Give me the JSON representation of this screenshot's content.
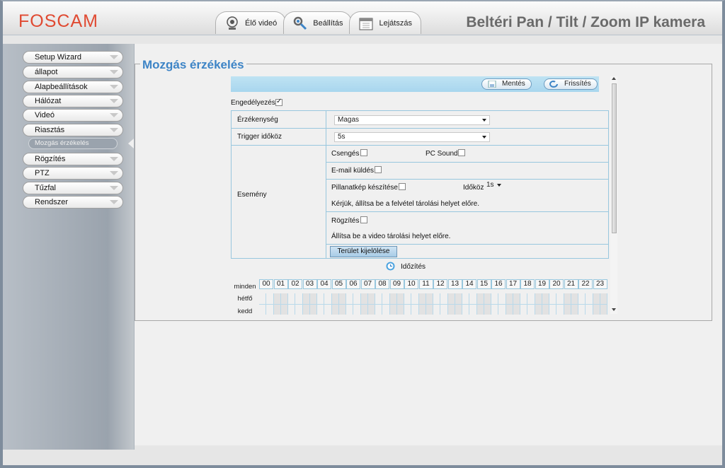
{
  "header": {
    "logo": "FOSCAM",
    "product_title": "Beltéri Pan / Tilt / Zoom IP kamera",
    "tabs": [
      {
        "label": "Élő videó",
        "icon": "webcam-icon"
      },
      {
        "label": "Beállítás",
        "icon": "tools-icon"
      },
      {
        "label": "Lejátszás",
        "icon": "calendar-icon"
      }
    ]
  },
  "sidebar": {
    "items": [
      {
        "label": "Setup Wizard"
      },
      {
        "label": "állapot"
      },
      {
        "label": "Alapbeállítások"
      },
      {
        "label": "Hálózat"
      },
      {
        "label": "Videó"
      },
      {
        "label": "Riasztás"
      },
      {
        "label": "Rögzítés"
      },
      {
        "label": "PTZ"
      },
      {
        "label": "Tűzfal"
      },
      {
        "label": "Rendszer"
      }
    ],
    "active_sub": "Mozgás érzékelés"
  },
  "main": {
    "title": "Mozgás érzékelés",
    "toolbar": {
      "save": "Mentés",
      "refresh": "Frissítés"
    },
    "enable_label": "Engedélyezés",
    "enable_checked": true,
    "sensitivity": {
      "label": "Érzékenység",
      "value": "Magas"
    },
    "trigger": {
      "label": "Trigger időköz",
      "value": "5s"
    },
    "event": {
      "label": "Esemény",
      "ring": "Csengés",
      "pc_sound": "PC Sound",
      "email": "E-mail küldés",
      "snapshot": "Pillanatkép készítése",
      "interval_label": "Időköz",
      "interval_value": "1s",
      "snapshot_hint": "Kérjük, állítsa be a felvétel tárolási helyet előre.",
      "record": "Rögzítés",
      "record_hint": "Állítsa be a video tárolási helyet előre.",
      "area_button": "Terület kijelölése"
    },
    "schedule": {
      "label": "Időzítés",
      "all_label": "minden",
      "hours": [
        "00",
        "01",
        "02",
        "03",
        "04",
        "05",
        "06",
        "07",
        "08",
        "09",
        "10",
        "11",
        "12",
        "13",
        "14",
        "15",
        "16",
        "17",
        "18",
        "19",
        "20",
        "21",
        "22",
        "23"
      ],
      "days": [
        "hétfő",
        "kedd"
      ]
    }
  },
  "colors": {
    "accent": "#3d84c6",
    "logo": "#e04a32",
    "grid": "#98c7de"
  }
}
